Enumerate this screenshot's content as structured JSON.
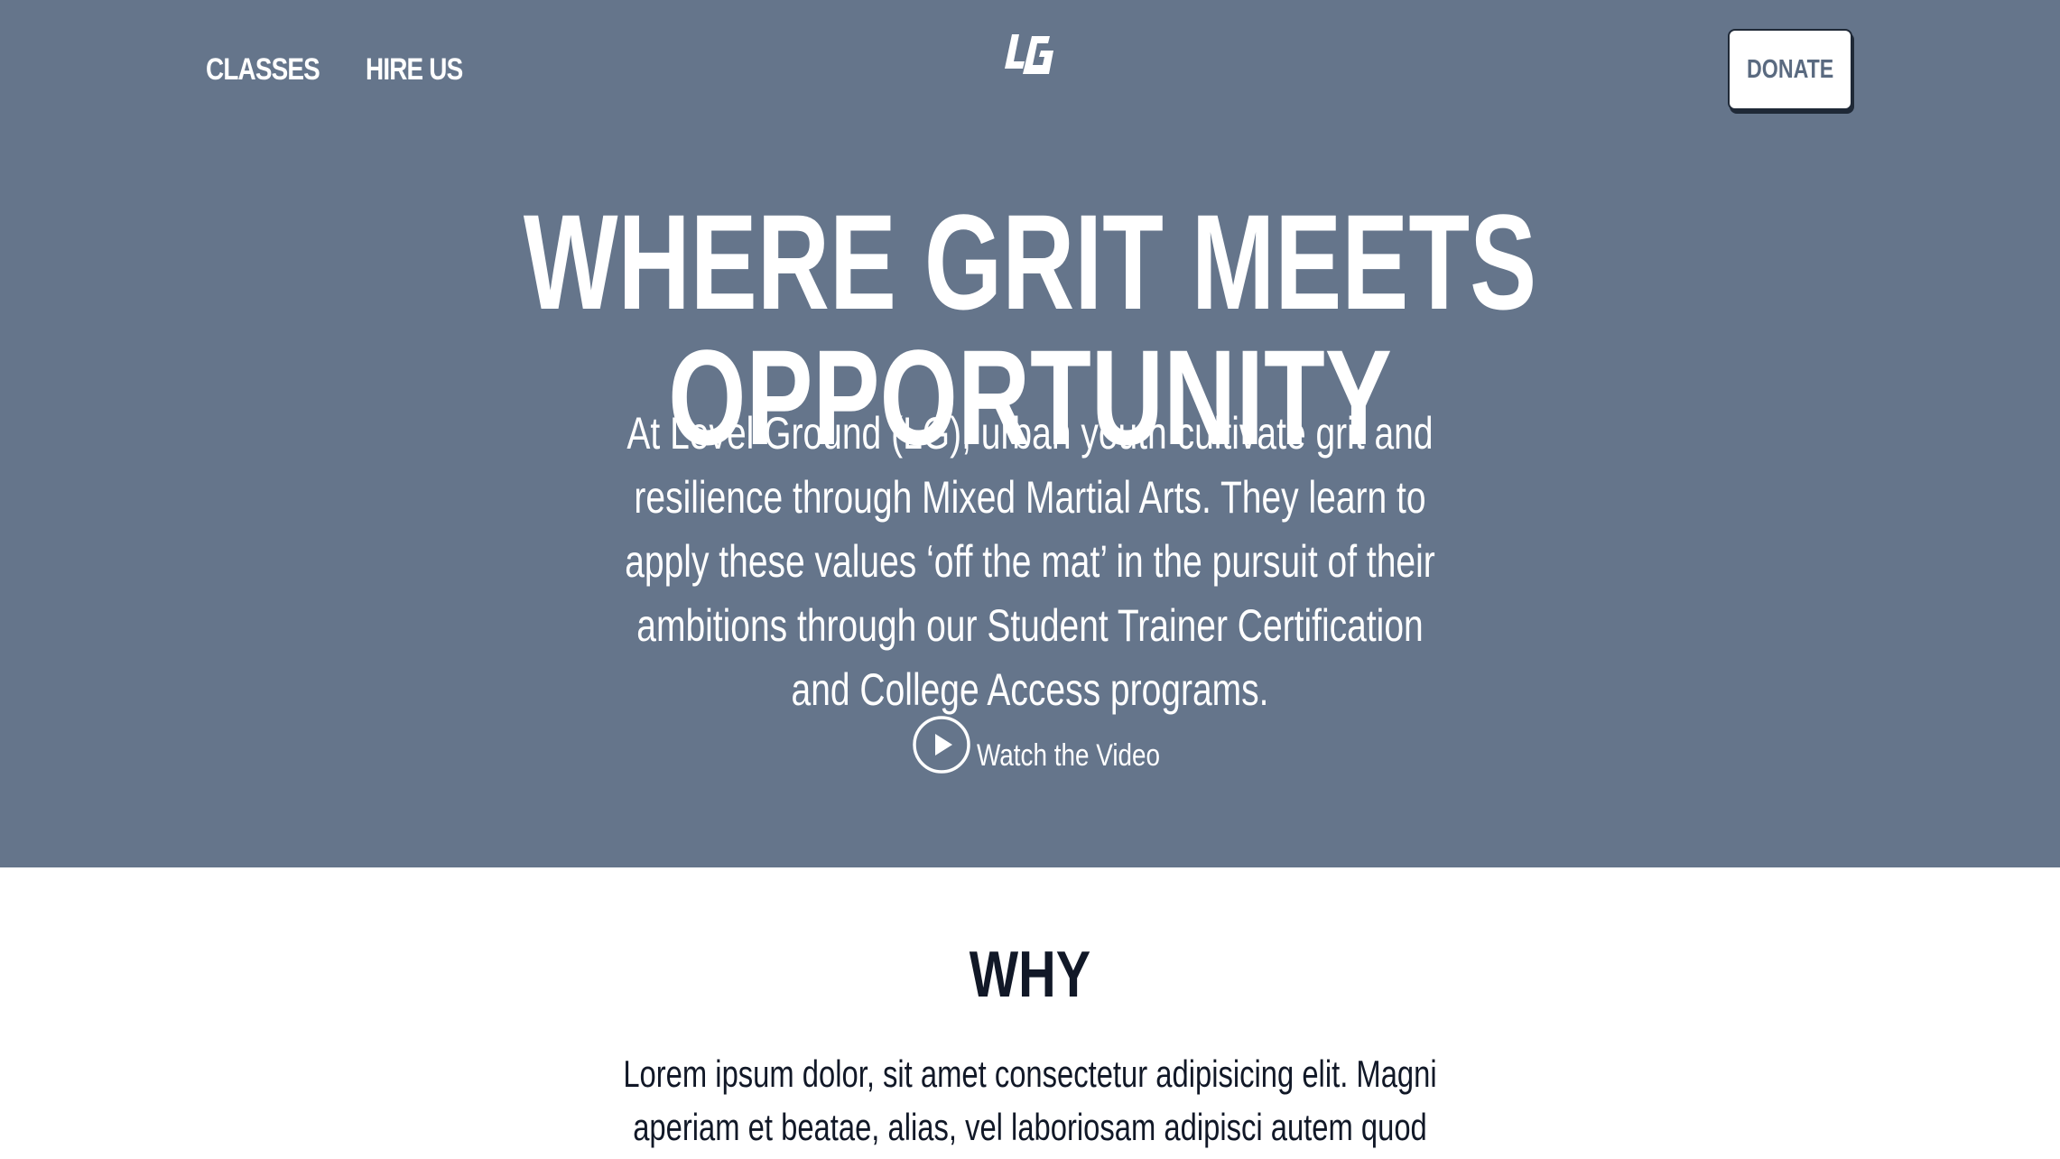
{
  "nav": {
    "classes_label": "CLASSES",
    "hire_label": "HIRE US",
    "logo_text": "LG",
    "donate_label": "DONATE"
  },
  "hero": {
    "headline": "WHERE GRIT MEETS OPPORTUNITY",
    "intro": "At Level Ground (LG), urban youth cultivate grit and resilience through Mixed Martial Arts. They learn to apply these values ‘off the mat’ in the pursuit of their ambitions through our Student Trainer Certification and College Access programs.",
    "video_label": "Watch the Video",
    "video_icon": "play-circle-icon"
  },
  "why": {
    "title": "WHY",
    "text": "Lorem ipsum dolor, sit amet consectetur adipisicing elit. Magni aperiam et beatae, alias, vel laboriosam adipisci autem quod"
  },
  "colors": {
    "hero_background": "#65758b",
    "hero_text": "#ffffff",
    "dark_text": "#111827",
    "donate_text": "#5a6a80"
  }
}
